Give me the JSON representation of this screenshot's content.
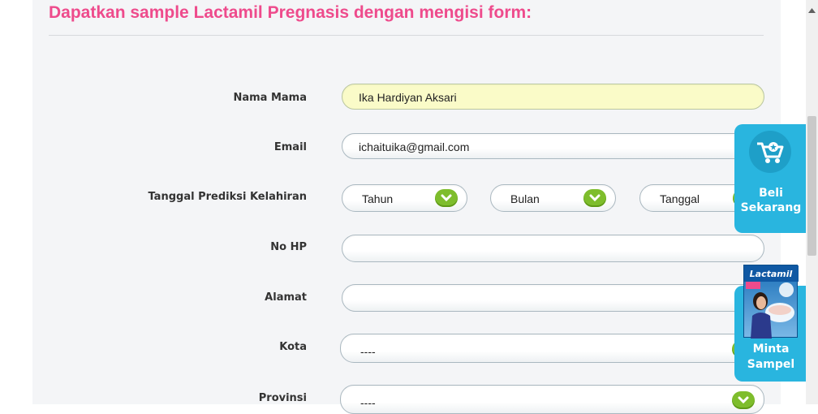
{
  "form": {
    "title": "Dapatkan sample Lactamil Pregnasis dengan mengisi form:",
    "fields": {
      "nama": {
        "label": "Nama Mama",
        "value": "Ika Hardiyan Aksari"
      },
      "email": {
        "label": "Email",
        "value": "ichaituika@gmail.com"
      },
      "tanggal": {
        "label": "Tanggal Prediksi Kelahiran",
        "tahun": "Tahun",
        "bulan": "Bulan",
        "tanggal": "Tanggal"
      },
      "hp": {
        "label": "No HP",
        "value": ""
      },
      "alamat": {
        "label": "Alamat",
        "value": ""
      },
      "kota": {
        "label": "Kota",
        "value": "----"
      },
      "provinsi": {
        "label": "Provinsi",
        "value": "----"
      }
    }
  },
  "widgets": {
    "beli": {
      "line1": "Beli",
      "line2": "Sekarang"
    },
    "sampel": {
      "brand": "Lactamil",
      "line1": "Minta",
      "line2": "Sampel"
    }
  },
  "colors": {
    "title": "#ee4b8c",
    "accent": "#29b5df",
    "chevron": "#7ebd2c",
    "filled_field": "#fafbc8"
  }
}
